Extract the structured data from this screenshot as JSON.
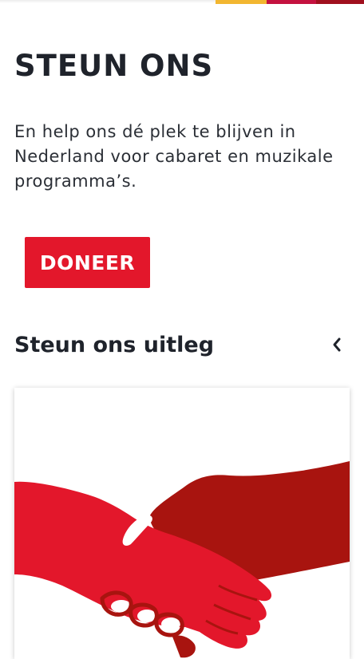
{
  "colors": {
    "accent_red": "#e3172b",
    "dark_red": "#a8140f",
    "top_bar_yellow": "#f2b630",
    "top_bar_crimson": "#c4113f",
    "top_bar_maroon": "#a00f1e",
    "text": "#1f232b"
  },
  "hero": {
    "title": "STEUN ONS",
    "intro": "En help ons dé plek te blijven in Nederland voor cabaret en muzikale programma’s."
  },
  "donate": {
    "label": "DONEER"
  },
  "section": {
    "title": "Steun ons uitleg",
    "nav_icon": "chevron-left-icon"
  },
  "card": {
    "illustration": "handshake-icon"
  }
}
